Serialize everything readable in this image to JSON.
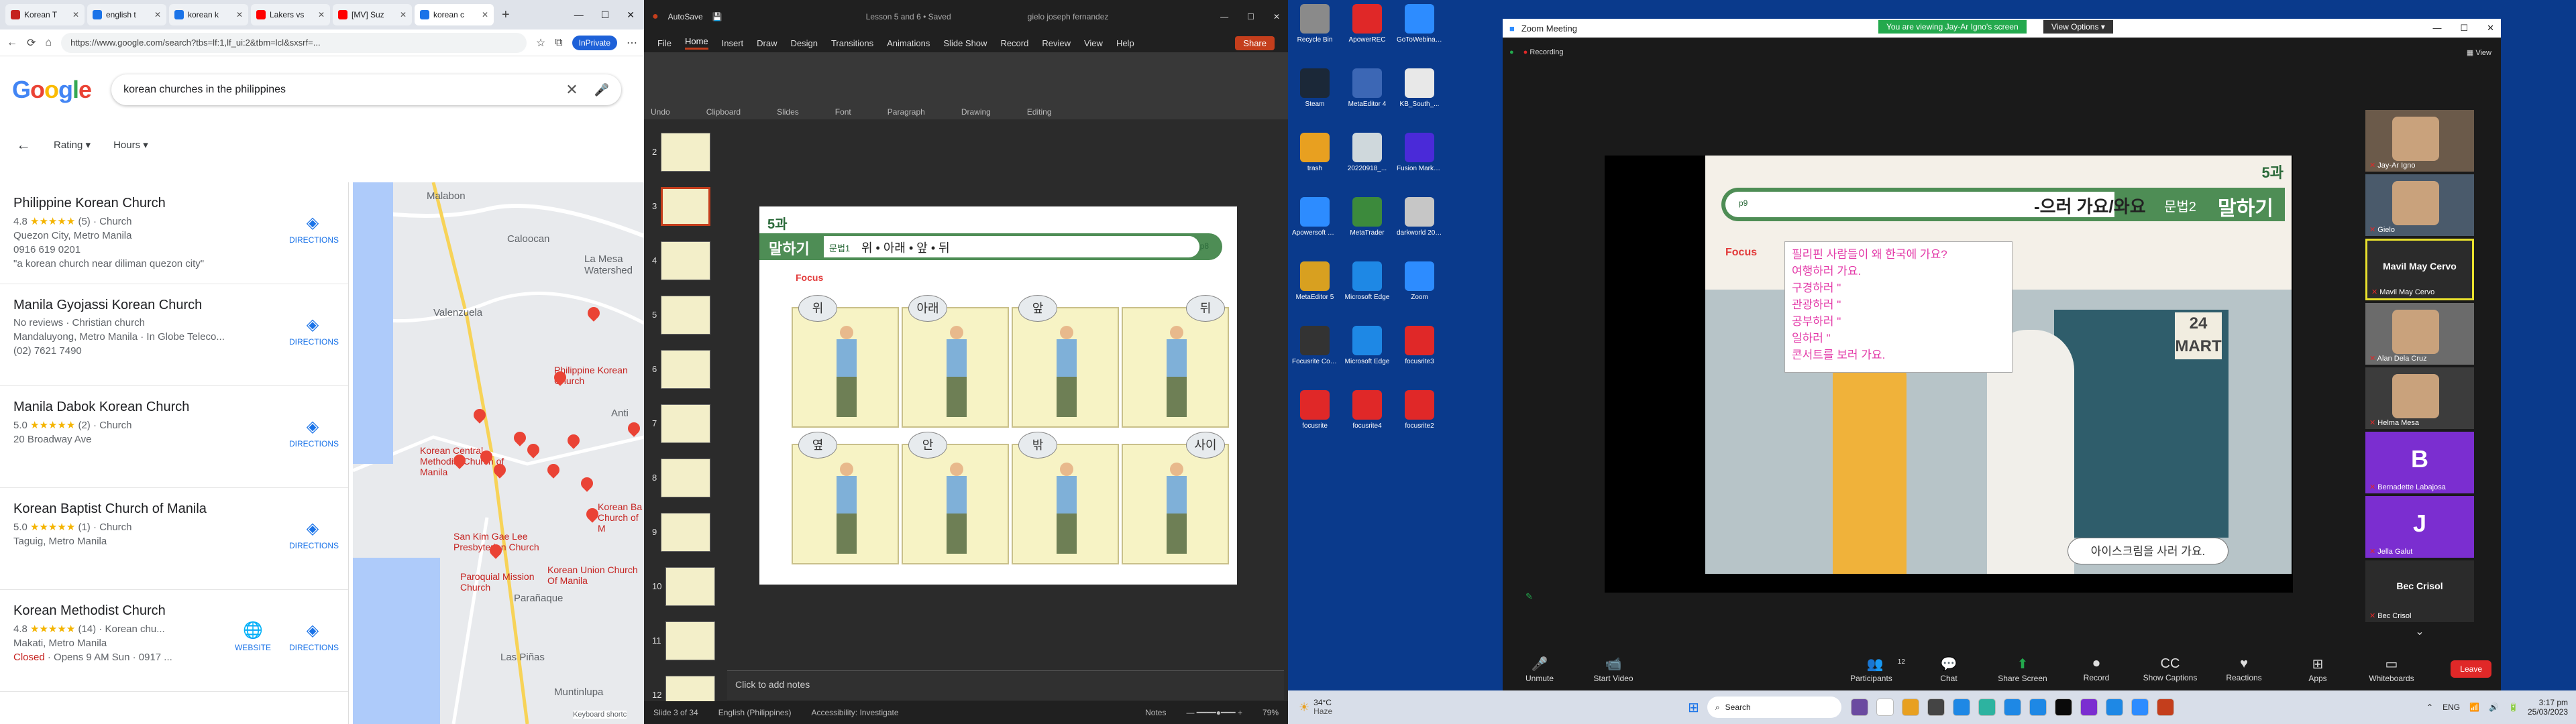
{
  "browser": {
    "tabs": [
      {
        "label": "Korean T",
        "color": "#c5221f"
      },
      {
        "label": "english t",
        "color": "#1a73e8"
      },
      {
        "label": "korean k",
        "color": "#1a73e8"
      },
      {
        "label": "Lakers vs",
        "color": "#ff0000"
      },
      {
        "label": "[MV] Suz",
        "color": "#ff0000"
      },
      {
        "label": "korean c",
        "color": "#1a73e8"
      }
    ],
    "url": "https://www.google.com/search?tbs=lf:1,lf_ui:2&tbm=lcl&sxsrf=...",
    "private_label": "InPrivate",
    "logo": "Google",
    "query": "korean churches in the philippines",
    "filters": [
      "Rating",
      "Hours"
    ],
    "places": [
      {
        "name": "Philippine Korean Church",
        "rating": "4.8",
        "stars": "★★★★★",
        "count": "(5)",
        "type": "Church",
        "addr": "Quezon City, Metro Manila",
        "phone": "0916 619 0201",
        "review": "\"a korean church near diliman quezon city\"",
        "dir": "DIRECTIONS"
      },
      {
        "name": "Manila Gyojassi Korean Church",
        "rating": "No reviews",
        "stars": "",
        "count": "",
        "type": "Christian church",
        "addr": "Mandaluyong, Metro Manila · In Globe Teleco...",
        "phone": "(02) 7621 7490",
        "review": "",
        "dir": "DIRECTIONS"
      },
      {
        "name": "Manila Dabok Korean Church",
        "rating": "5.0",
        "stars": "★★★★★",
        "count": "(2)",
        "type": "Church",
        "addr": "20 Broadway Ave",
        "phone": "",
        "review": "",
        "dir": "DIRECTIONS"
      },
      {
        "name": "Korean Baptist Church of Manila",
        "rating": "5.0",
        "stars": "★★★★★",
        "count": "(1)",
        "type": "Church",
        "addr": "Taguig, Metro Manila",
        "phone": "",
        "review": "",
        "dir": "DIRECTIONS"
      },
      {
        "name": "Korean Methodist Church",
        "rating": "4.8",
        "stars": "★★★★★",
        "count": "(14)",
        "type": "Korean chu...",
        "addr": "Makati, Metro Manila",
        "phone": "",
        "review": "",
        "closed": "Closed",
        "hours": "· Opens 9 AM Sun · 0917 ...",
        "dir": "DIRECTIONS",
        "web": "WEBSITE"
      }
    ],
    "map_labels": [
      "Malabon",
      "Caloocan",
      "La Mesa Watershed",
      "Valenzuela",
      "Philippine Korean Church",
      "Korean Central Methodist Church of Manila",
      "Korean Union Church Of Manila",
      "Parañaque",
      "Las Piñas",
      "Muntinlupa",
      "San Kim Gae Lee Presbyterian Church",
      "Paroquial Mission Church",
      "Korean Ba Church of M",
      "Anti"
    ],
    "keyboard": "Keyboard shortc"
  },
  "ppt": {
    "app": "AutoSave",
    "file": "Lesson 5 and 6 • Saved",
    "user": "gielo joseph fernandez",
    "menus": [
      "File",
      "Home",
      "Insert",
      "Draw",
      "Design",
      "Transitions",
      "Animations",
      "Slide Show",
      "Record",
      "Review",
      "View",
      "Help"
    ],
    "share": "Share",
    "ribbon_groups": [
      "Undo",
      "Clipboard",
      "Slides",
      "Font",
      "Paragraph",
      "Drawing",
      "Editing"
    ],
    "slide_numbers": [
      "2",
      "3",
      "4",
      "5",
      "6",
      "7",
      "8",
      "9",
      "10",
      "11",
      "12"
    ],
    "slide": {
      "lesson": "5과",
      "title": "말하기",
      "sub": "문법1",
      "words": "위 • 아래 • 앞 • 뒤",
      "page": "p8",
      "focus": "Focus",
      "bubbles": [
        "위",
        "아래",
        "앞",
        "뒤",
        "옆",
        "안",
        "밖",
        "사이"
      ]
    },
    "notes": "Click to add notes",
    "status": {
      "slide": "Slide 3 of 34",
      "lang": "English (Philippines)",
      "access": "Accessibility: Investigate",
      "notes": "Notes",
      "zoom": "79%"
    }
  },
  "desktop": {
    "icons": [
      "Recycle Bin",
      "ApowerREC",
      "GoToWebinar 001",
      "Steam",
      "MetaEditor 4",
      "KB_South_...",
      "trash",
      "20220918_...",
      "Fusion Markets M...",
      "Apowersoft Video Co...",
      "MetaTrader",
      "darkworld 2022",
      "MetaEditor 5",
      "Microsoft Edge",
      "Zoom",
      "Focusrite Control",
      "Microsoft Edge",
      "focusrite3",
      "focusrite",
      "focusrite4",
      "focusrite2"
    ]
  },
  "zoom": {
    "title": "Zoom Meeting",
    "recording": "Recording",
    "viewing": "You are viewing Jay-Ar Igno's screen",
    "view_options": "View Options",
    "view": "View",
    "slide": {
      "lesson": "5과",
      "heading": "-으러 가요/와요",
      "tag": "문법2",
      "title": "말하기",
      "page": "p9",
      "focus": "Focus",
      "lines": [
        "필리핀 사람들이 왜 한국에 가요?",
        "여행하러 가요.",
        "구경하러 \"",
        "관광하러 \"",
        "공부하러 \"",
        "일하러 \"",
        "콘서트를 보러 가요."
      ],
      "sign": "24 MART",
      "bubble": "아이스크림을 사러 가요."
    },
    "participants": [
      {
        "name": "Jay-Ar Igno",
        "initial": ""
      },
      {
        "name": "Gielo",
        "initial": ""
      },
      {
        "name": "Mavil May Cervo",
        "initial": "Mavil May Cervo"
      },
      {
        "name": "Alan Dela Cruz",
        "initial": ""
      },
      {
        "name": "Helma Mesa",
        "initial": ""
      },
      {
        "name": "Bernadette Labajosa",
        "initial": "B"
      },
      {
        "name": "Jella Galut",
        "initial": "J"
      },
      {
        "name": "Bec Crisol",
        "initial": "Bec Crisol"
      }
    ],
    "controls": [
      "Unmute",
      "Start Video",
      "Participants",
      "Chat",
      "Share Screen",
      "Record",
      "Show Captions",
      "Reactions",
      "Apps",
      "Whiteboards"
    ],
    "participant_count": "12",
    "leave": "Leave"
  },
  "taskbar": {
    "weather": "34°C",
    "weather_sub": "Haze",
    "search": "Search",
    "lang": "ENG",
    "time": "3:17 pm",
    "date": "25/03/2023"
  }
}
